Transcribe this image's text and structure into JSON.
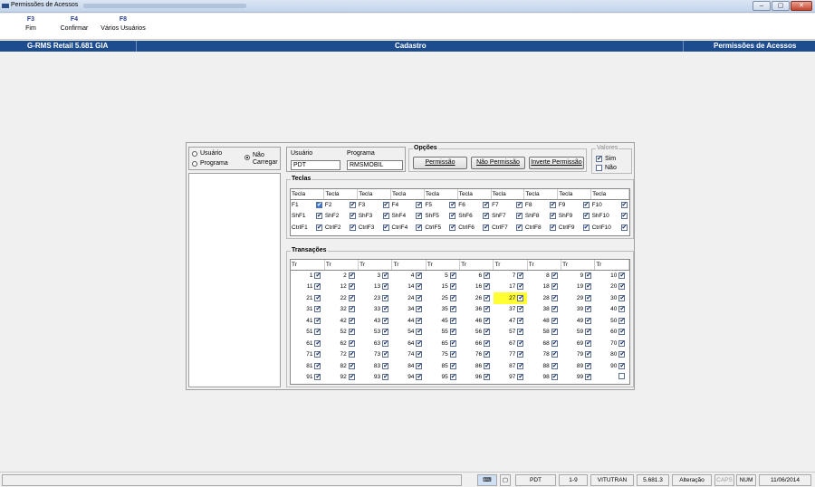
{
  "window": {
    "title": "Permissões de Acessos"
  },
  "fkeys": [
    {
      "key": "F3",
      "label": "Fim"
    },
    {
      "key": "F4",
      "label": "Confirmar"
    },
    {
      "key": "F8",
      "label": "Vários Usuários"
    }
  ],
  "header": {
    "app": "G-RMS Retail 5.681 GIA",
    "center": "Cadastro",
    "right": "Permissões de Acessos"
  },
  "mode": {
    "usuario": "Usuário",
    "programa": "Programa",
    "nao_carregar": "Não Carregar"
  },
  "fields": {
    "usuario_label": "Usuário",
    "usuario_value": "PDT",
    "programa_label": "Programa",
    "programa_value": "RMSMOBIL"
  },
  "opcoes": {
    "title": "Opções",
    "permissao": "Permissão",
    "nao_permissao": "Não Permissão",
    "inverte": "Inverte Permissão"
  },
  "valores": {
    "title": "Valores",
    "sim": "Sim",
    "nao": "Não"
  },
  "teclas": {
    "title": "Teclas",
    "header": "Tecla",
    "rows": [
      [
        "F1",
        "F2",
        "F3",
        "F4",
        "F5",
        "F6",
        "F7",
        "F8",
        "F9",
        "F10"
      ],
      [
        "ShF1",
        "ShF2",
        "ShF3",
        "ShF4",
        "ShF5",
        "ShF6",
        "ShF7",
        "ShF8",
        "ShF9",
        "ShF10"
      ],
      [
        "CtrlF1",
        "CtrlF2",
        "CtrlF3",
        "CtrlF4",
        "CtrlF5",
        "CtrlF6",
        "CtrlF7",
        "CtrlF8",
        "CtrlF9",
        "CtrlF10"
      ]
    ]
  },
  "transacoes": {
    "title": "Transações",
    "header": "Tr",
    "highlighted": "27",
    "unchecked": [
      "100"
    ]
  },
  "status": {
    "user": "PDT",
    "range": "1-9",
    "server": "VITUTRAN",
    "version": "5.681.3",
    "mode": "Alteração",
    "caps": "CAPS",
    "num": "NUM",
    "date": "11/06/2014"
  }
}
